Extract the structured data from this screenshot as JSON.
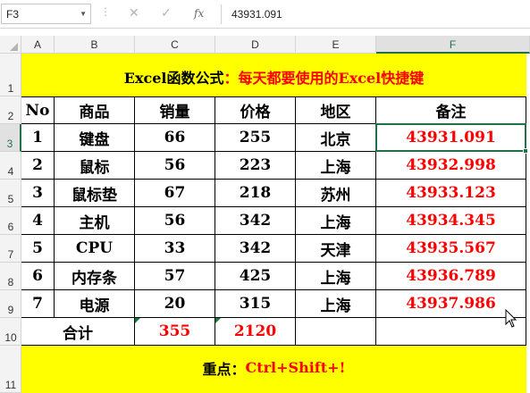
{
  "formula_bar": {
    "name_box": "F3",
    "name_box_icon": "chevron-down-icon",
    "more_icon": "vertical-dots-icon",
    "cancel_icon": "close-icon",
    "enter_icon": "check-icon",
    "fx_label": "fx",
    "formula_value": "43931.091"
  },
  "columns": [
    "A",
    "B",
    "C",
    "D",
    "E",
    "F"
  ],
  "rows": [
    "1",
    "2",
    "3",
    "4",
    "5",
    "6",
    "7",
    "8",
    "9",
    "10",
    "11"
  ],
  "sheet": {
    "title_black": "Excel函数公式",
    "title_red": "：每天都要使用的Excel快捷键",
    "headers": [
      "No",
      "商品",
      "销量",
      "价格",
      "地区",
      "备注"
    ],
    "data": [
      [
        "1",
        "键盘",
        "66",
        "255",
        "北京",
        "43931.091"
      ],
      [
        "2",
        "鼠标",
        "56",
        "223",
        "上海",
        "43932.998"
      ],
      [
        "3",
        "鼠标垫",
        "67",
        "218",
        "苏州",
        "43933.123"
      ],
      [
        "4",
        "主机",
        "56",
        "342",
        "上海",
        "43934.345"
      ],
      [
        "5",
        "CPU",
        "33",
        "342",
        "天津",
        "43935.567"
      ],
      [
        "6",
        "内存条",
        "57",
        "425",
        "上海",
        "43936.789"
      ],
      [
        "7",
        "电源",
        "20",
        "315",
        "上海",
        "43937.986"
      ]
    ],
    "total_label": "合计",
    "total_sales": "355",
    "total_price": "2120",
    "footer_black": "重点：",
    "footer_red": "Ctrl+Shift+!"
  },
  "colors": {
    "banner": "#ffff00",
    "accent_red": "#ff0000",
    "selection": "#217346"
  }
}
